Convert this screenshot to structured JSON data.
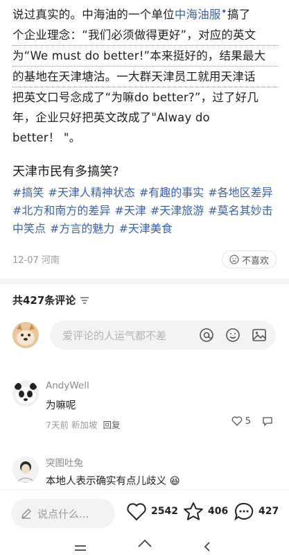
{
  "article": {
    "l1a": "说过真实的。中海油的一个单位",
    "l1link": "中海油服",
    "l1b": "搞了",
    "l2": "个企业理念：“我们必须做得更好”，对应的英文",
    "l3": "为“We must do better!”本来挺好的，结果最大",
    "l4": "的基地在天津塘沽。一大群天津员工就用天津话",
    "l5": "把英文口号念成了“为嘛do better?”，过了好几",
    "l6": "年，企业只好把英文改成了\"Alway do",
    "l7": "better！ \"。"
  },
  "question_title": "天津市民有多搞笑?",
  "tags": [
    "#搞笑",
    "#天津人精神状态",
    "#有趣的事实",
    "#各地区差异",
    "#北方和南方的差异",
    "#天津",
    "#天津旅游",
    "#莫名其妙击中笑点",
    "#方言的魅力",
    "#天津美食"
  ],
  "meta": {
    "date_location": "12-07 河南",
    "dislike_label": "不喜欢"
  },
  "comments_header": {
    "label": "共427条评论"
  },
  "comment_input": {
    "placeholder": "爱评论的人运气都不差"
  },
  "comments": [
    {
      "name": "AndyWell",
      "text": "为嘛呢",
      "time_location": "7天前 新加坡",
      "reply": "回复",
      "likes": "5"
    },
    {
      "name": "突图吐兔",
      "text": "本地人表示确实有点儿歧义"
    }
  ],
  "bottom_bar": {
    "say_placeholder": "说点什么...",
    "likes": "2542",
    "stars": "406",
    "comments": "427"
  },
  "colors": {
    "tag": "#3d62a8",
    "text": "#1f1f1f",
    "muted": "#9a9a9a"
  }
}
